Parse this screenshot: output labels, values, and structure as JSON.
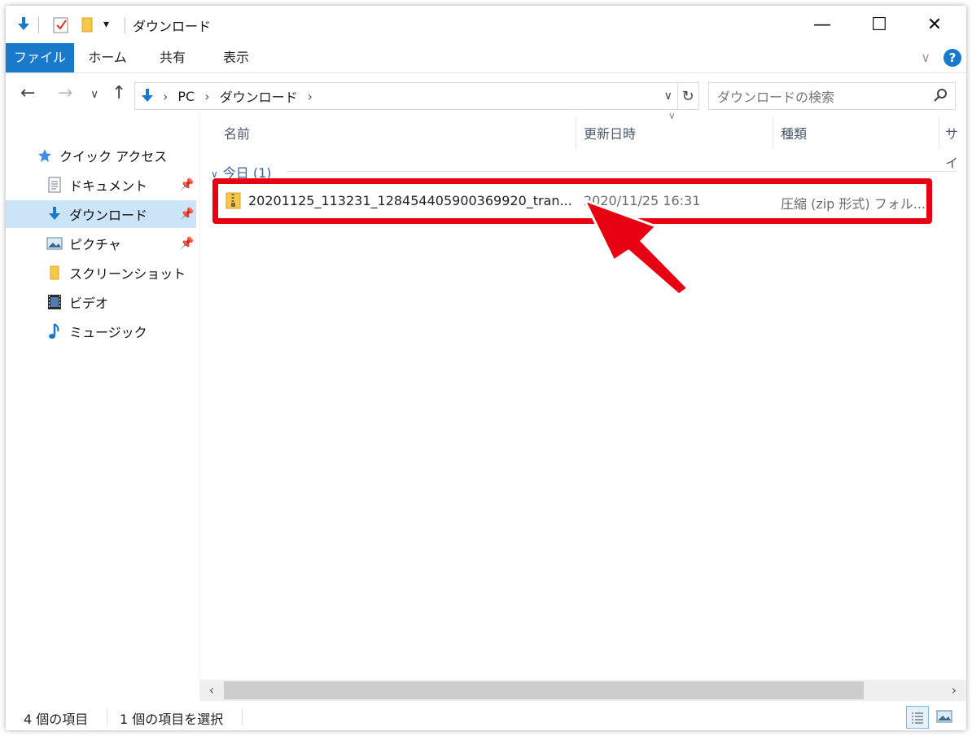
{
  "window": {
    "title": "ダウンロード",
    "minimize_glyph": "—",
    "maximize_glyph": "☐",
    "close_glyph": "✕"
  },
  "ribbon": {
    "tabs": [
      "ファイル",
      "ホーム",
      "共有",
      "表示"
    ],
    "help_glyph": "?",
    "collapse_glyph": "∨"
  },
  "nav": {
    "back_glyph": "←",
    "forward_glyph": "→",
    "recent_glyph": "∨",
    "up_glyph": "↑",
    "breadcrumb": [
      "PC",
      "ダウンロード"
    ],
    "separator": "›",
    "dropdown_glyph": "∨",
    "refresh_glyph": "↻",
    "search_placeholder": "ダウンロードの検索"
  },
  "sidebar": {
    "quick_access": "クイック アクセス",
    "items": [
      {
        "label": "ドキュメント",
        "icon": "document-icon",
        "pinned": true
      },
      {
        "label": "ダウンロード",
        "icon": "download-icon",
        "pinned": true,
        "selected": true
      },
      {
        "label": "ピクチャ",
        "icon": "picture-icon",
        "pinned": true
      },
      {
        "label": "スクリーンショット",
        "icon": "folder-icon",
        "pinned": false
      },
      {
        "label": "ビデオ",
        "icon": "video-icon",
        "pinned": false
      },
      {
        "label": "ミュージック",
        "icon": "music-icon",
        "pinned": false
      }
    ]
  },
  "file_list": {
    "columns": [
      "名前",
      "更新日時",
      "種類",
      "サイ"
    ],
    "group": "今日 (1)",
    "rows": [
      {
        "name": "20201125_113231_128454405900369920_tran...",
        "modified": "2020/11/25 16:31",
        "modified_visible": "20/11/25 16:31",
        "type": "圧縮 (zip 形式) フォル...",
        "icon": "zip-folder-icon"
      }
    ]
  },
  "status": {
    "item_count": "4 個の項目",
    "selected": "1 個の項目を選択"
  },
  "colors": {
    "accent": "#1979ca",
    "highlight": "#e60012",
    "selected_bg": "#cce4f7"
  }
}
